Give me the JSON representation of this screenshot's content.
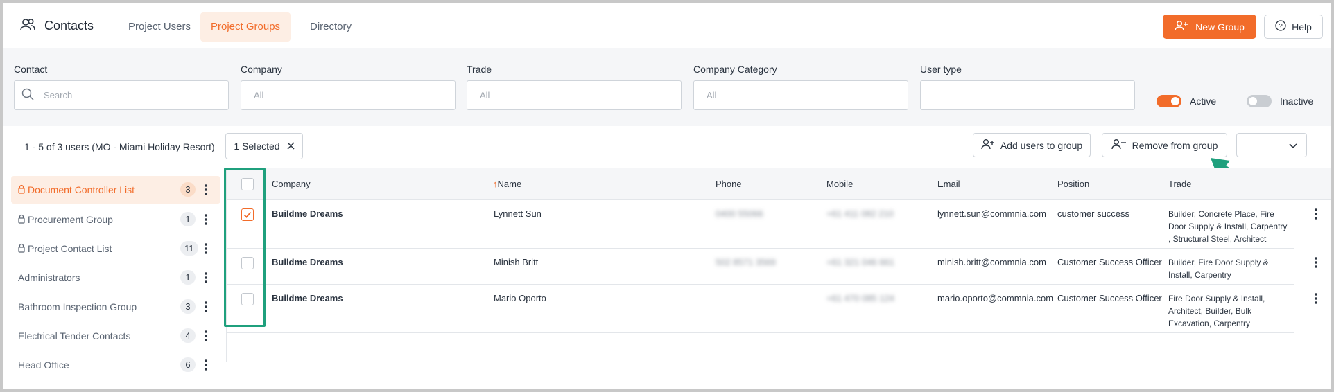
{
  "header": {
    "title": "Contacts",
    "tabs": [
      {
        "label": "Project Users"
      },
      {
        "label": "Project Groups"
      },
      {
        "label": "Directory"
      }
    ],
    "new_group_label": "New Group",
    "help_label": "Help"
  },
  "filters": {
    "contact": {
      "label": "Contact",
      "placeholder": "Search"
    },
    "company": {
      "label": "Company",
      "placeholder": "All"
    },
    "trade": {
      "label": "Trade",
      "placeholder": "All"
    },
    "company_category": {
      "label": "Company Category",
      "placeholder": "All"
    },
    "user_type": {
      "label": "User type",
      "placeholder": ""
    },
    "active_label": "Active",
    "inactive_label": "Inactive"
  },
  "toolbar": {
    "count_text": "1 - 5 of 3 users (MO - Miami Holiday Resort)",
    "selected_label": "1 Selected",
    "add_users_label": "Add users to group",
    "remove_label": "Remove from group"
  },
  "sidebar": {
    "items": [
      {
        "label": "Document Controller List",
        "count": "3",
        "locked": true,
        "active": true
      },
      {
        "label": "Procurement Group",
        "count": "1",
        "locked": true
      },
      {
        "label": "Project Contact List",
        "count": "11",
        "locked": true
      },
      {
        "label": "Administrators",
        "count": "1"
      },
      {
        "label": "Bathroom Inspection Group",
        "count": "3"
      },
      {
        "label": "Electrical Tender Contacts",
        "count": "4"
      },
      {
        "label": "Head Office",
        "count": "6"
      }
    ]
  },
  "table": {
    "columns": [
      "Company",
      "Name",
      "Phone",
      "Mobile",
      "Email",
      "Position",
      "Trade"
    ],
    "sort_indicator": "↑",
    "rows": [
      {
        "company": "Buildme Dreams",
        "name": "Lynnett Sun",
        "phone": "0400 55066",
        "mobile": "+61 411 082 210",
        "email": "lynnett.sun@commnia.com",
        "position": "customer success",
        "trade_lines": [
          "Builder, Concrete Place, Fire",
          "Door Supply & Install, Carpentry",
          ", Structural Steel, Architect"
        ],
        "checked": true
      },
      {
        "company": "Buildme Dreams",
        "name": "Minish Britt",
        "phone": "502 8571 3569",
        "mobile": "+61 321 046 661",
        "email": "minish.britt@commnia.com",
        "position": "Customer Success Officer",
        "trade_lines": [
          "Builder, Fire Door Supply &",
          "Install, Carpentry"
        ],
        "checked": false
      },
      {
        "company": "Buildme Dreams",
        "name": "Mario Oporto",
        "phone": "",
        "mobile": "+61 470 085 124",
        "email": "mario.oporto@commnia.com",
        "position": "Customer Success Officer",
        "trade_lines": [
          "Fire Door Supply & Install,",
          "Architect, Builder, Bulk",
          "Excavation, Carpentry"
        ],
        "checked": false
      }
    ]
  },
  "colors": {
    "accent": "#f26c2a",
    "highlight": "#1fa07d"
  }
}
